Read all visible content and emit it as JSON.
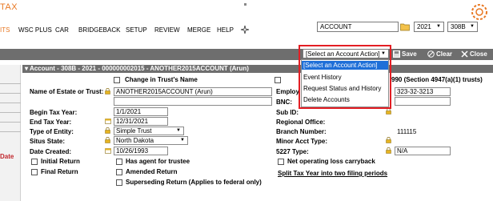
{
  "app": {
    "logo_text": "TAX"
  },
  "menu": {
    "items": [
      "ITS",
      "WSC PLUS",
      "CAR",
      "BRIDGEBACK",
      "SETUP",
      "REVIEW",
      "MERGE",
      "HELP"
    ]
  },
  "search": {
    "account_value": "ACCOUNT"
  },
  "selectors": {
    "year": "2021",
    "code": "308B"
  },
  "toolbar": {
    "action_select": "[Select an Account Action]",
    "save_label": "Save",
    "clear_label": "Clear",
    "close_label": "Close"
  },
  "dropdown": {
    "options": [
      "[Select an Account Action]",
      "Event History",
      "Request Status and History",
      "Delete Accounts"
    ]
  },
  "section": {
    "header": "Account - 308B - 2021 - 000000002015 - ANOTHER2015ACCOUNT (Arun)"
  },
  "left_panel": {
    "date_label": "Date"
  },
  "form": {
    "change_trust_name": "Change in Trust's Name",
    "estate_name_label": "Name of Estate or Trust:",
    "estate_name_value": "ANOTHER2015ACCOUNT (Arun)",
    "begin_year_label": "Begin Tax Year:",
    "begin_year_value": "1/1/2021",
    "end_year_label": "End Tax Year:",
    "end_year_value": "12/31/2021",
    "entity_type_label": "Type of Entity:",
    "entity_type_value": "Simple Trust",
    "situs_label": "Situs State:",
    "situs_value": "North Dakota",
    "date_created_label": "Date Created:",
    "date_created_value": "10/26/1993",
    "initial_return": "Initial Return",
    "final_return": "Final Return",
    "agent_for_trustee": "Has agent for trustee",
    "amended_return": "Amended Return",
    "superseding_return": "Superseding Return (Applies to federal only)",
    "trust_4947_text": "990 (Section 4947(a)(1) trusts)",
    "employer_id_label": "Employ",
    "employer_id_value": "323-32-3213",
    "bnc_label": "BNC:",
    "sub_id_label": "Sub ID:",
    "regional_office_label": "Regional Office:",
    "branch_number_label": "Branch Number:",
    "branch_number_value": "111115",
    "minor_acct_label": "Minor Acct Type:",
    "type_5227_label": "5227 Type:",
    "type_5227_value": "N/A",
    "nol_carryback": "Net operating loss carryback",
    "split_tax_year_link": "Split Tax Year into two filing periods"
  }
}
